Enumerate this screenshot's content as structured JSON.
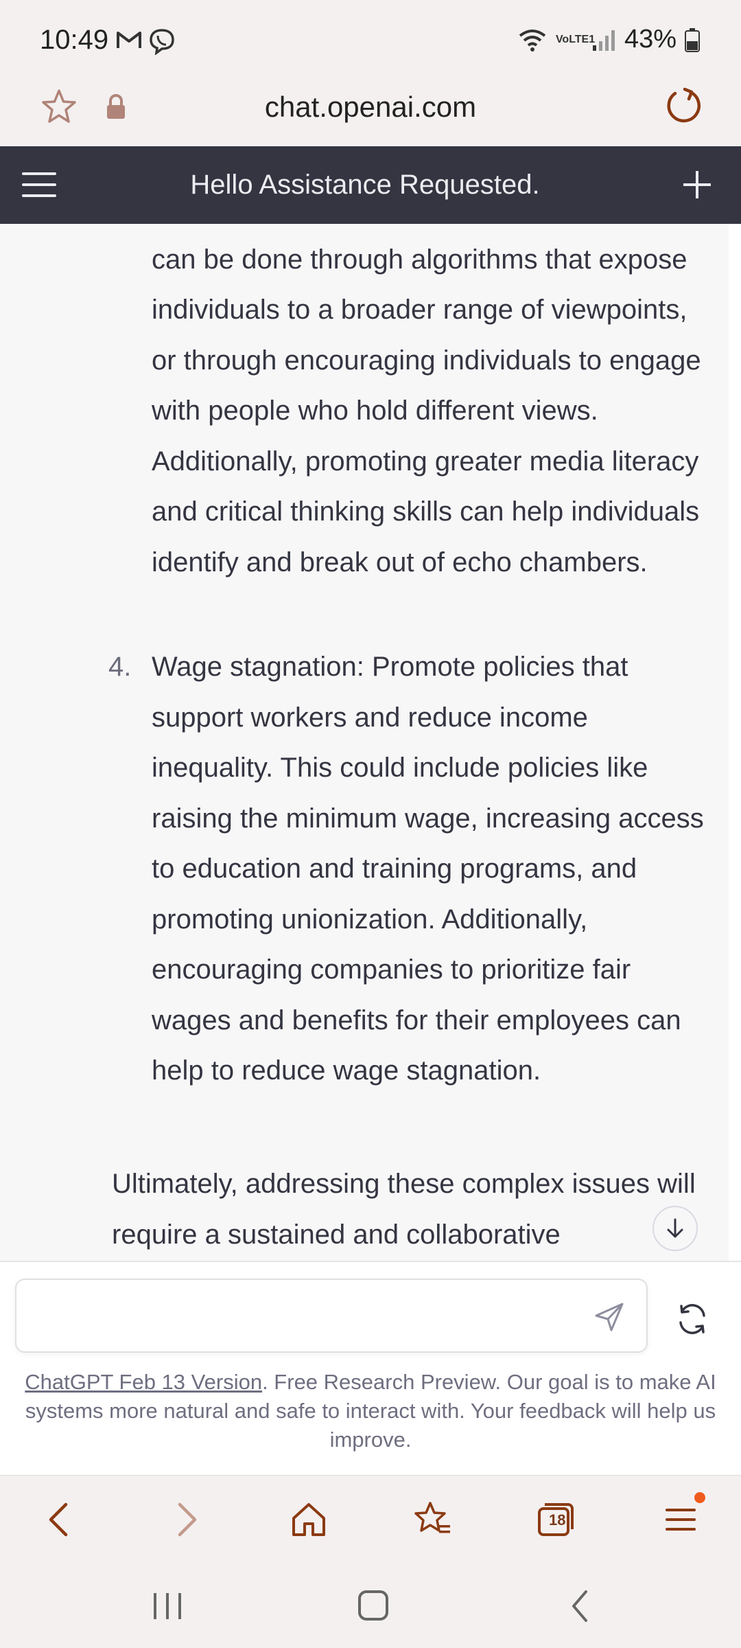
{
  "status_bar": {
    "time": "10:49",
    "battery": "43%",
    "network": "VoLTE1"
  },
  "browser": {
    "url": "chat.openai.com",
    "tabs_count": "18"
  },
  "header": {
    "title": "Hello Assistance Requested."
  },
  "conversation": {
    "item3_text": "greater exposure to diverse perspectives. This can be done through algorithms that expose individuals to a broader range of viewpoints, or through encouraging individuals to engage with people who hold different views. Additionally, promoting greater media literacy and critical thinking skills can help individuals identify and break out of echo chambers.",
    "item4_number": "4.",
    "item4_text": "Wage stagnation: Promote policies that support workers and reduce income inequality. This could include policies like raising the minimum wage, increasing access to education and training programs, and promoting unionization. Additionally, encouraging companies to prioritize fair wages and benefits for their employees can help to reduce wage stagnation.",
    "conclusion_text": "Ultimately, addressing these complex issues will require a sustained and collaborative"
  },
  "composer": {
    "placeholder": ""
  },
  "footer": {
    "link_text": "ChatGPT Feb 13 Version",
    "note_text": ". Free Research Preview. Our goal is to make AI systems more natural and safe to interact with. Your feedback will help us improve."
  },
  "colors": {
    "header_bg": "#343541",
    "browser_accent": "#8b3a12",
    "notification_dot": "#f05a1d"
  }
}
